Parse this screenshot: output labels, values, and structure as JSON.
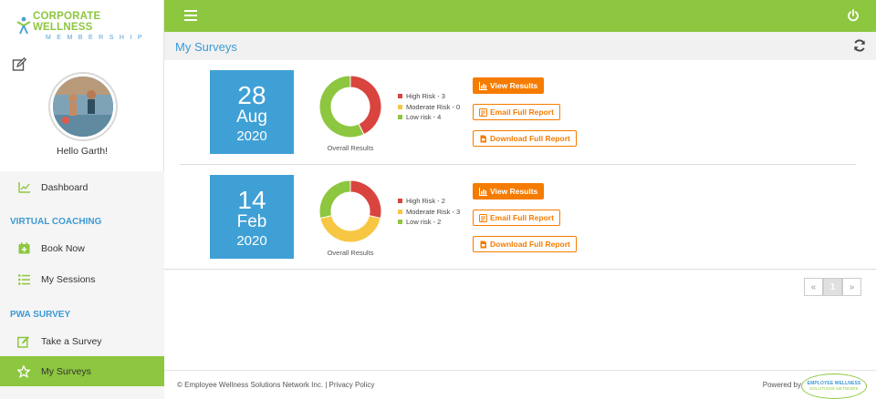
{
  "brand": {
    "name_line1": "CORPORATE WELLNESS",
    "name_line2": "MEMBERSHIP"
  },
  "sidebar": {
    "greeting": "Hello Garth!",
    "items": [
      {
        "label": "Dashboard",
        "icon": "chart-icon"
      },
      {
        "section": "VIRTUAL COACHING"
      },
      {
        "label": "Book Now",
        "icon": "calendar-plus-icon"
      },
      {
        "label": "My Sessions",
        "icon": "list-icon"
      },
      {
        "section": "PWA SURVEY"
      },
      {
        "label": "Take a Survey",
        "icon": "edit-icon"
      },
      {
        "label": "My Surveys",
        "icon": "star-icon",
        "active": true
      }
    ]
  },
  "header": {
    "title": "My Surveys"
  },
  "surveys": [
    {
      "day": "28",
      "month": "Aug",
      "year": "2020",
      "caption": "Overall Results",
      "risk": [
        {
          "label": "High Risk - 3",
          "count": 3,
          "color": "#d9443f"
        },
        {
          "label": "Moderate Risk - 0",
          "count": 0,
          "color": "#f7c744"
        },
        {
          "label": "Low risk - 4",
          "count": 4,
          "color": "#8dc63f"
        }
      ],
      "view_label": "View Results",
      "email_label": "Email Full Report",
      "download_label": "Download Full Report"
    },
    {
      "day": "14",
      "month": "Feb",
      "year": "2020",
      "caption": "Overall Results",
      "risk": [
        {
          "label": "High Risk - 2",
          "count": 2,
          "color": "#d9443f"
        },
        {
          "label": "Moderate Risk - 3",
          "count": 3,
          "color": "#f7c744"
        },
        {
          "label": "Low risk - 2",
          "count": 2,
          "color": "#8dc63f"
        }
      ],
      "view_label": "View Results",
      "email_label": "Email Full Report",
      "download_label": "Download Full Report"
    }
  ],
  "pagination": {
    "prev": "«",
    "current": "1",
    "next": "»"
  },
  "footer": {
    "copyright": "© Employee Wellness Solutions Network Inc. | Privacy Policy",
    "powered_by": "Powered by",
    "logo_line1": "EMPLOYEE WELLNESS",
    "logo_line2": "SOLUTIONS NETWORK"
  },
  "colors": {
    "accent_green": "#8dc63f",
    "accent_blue": "#3fa0d6",
    "button_orange": "#f57c00"
  }
}
